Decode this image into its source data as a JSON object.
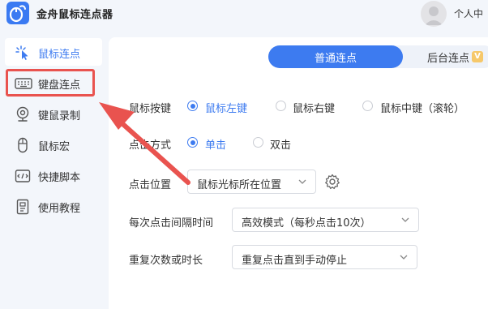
{
  "app": {
    "title": "金舟鼠标连点器",
    "user_label": "个人中"
  },
  "sidebar": {
    "items": [
      {
        "label": "鼠标连点",
        "icon": "mouse-click-icon",
        "active": true
      },
      {
        "label": "键盘连点",
        "icon": "keyboard-icon",
        "active": false
      },
      {
        "label": "键鼠录制",
        "icon": "record-icon",
        "active": false
      },
      {
        "label": "鼠标宏",
        "icon": "mouse-icon",
        "active": false
      },
      {
        "label": "快捷脚本",
        "icon": "script-icon",
        "active": false
      },
      {
        "label": "使用教程",
        "icon": "tutorial-icon",
        "active": false
      }
    ]
  },
  "tabs": {
    "normal": "普通连点",
    "background": "后台连点",
    "badge": "V"
  },
  "settings": {
    "mouse_button": {
      "label": "鼠标按键",
      "options": [
        "鼠标左键",
        "鼠标右键",
        "鼠标中键（滚轮）"
      ],
      "selected": "鼠标左键"
    },
    "click_mode": {
      "label": "点击方式",
      "options": [
        "单击",
        "双击"
      ],
      "selected": "单击"
    },
    "click_position": {
      "label": "点击位置",
      "value": "鼠标光标所在位置"
    },
    "interval": {
      "label": "每次点击间隔时间",
      "value": "高效模式（每秒点击10次）"
    },
    "repeat": {
      "label": "重复次数或时长",
      "value": "重复点击直到手动停止"
    }
  },
  "colors": {
    "accent": "#3d7bf0",
    "highlight": "#e9534f",
    "sidebar_bg": "#f3f6fb"
  }
}
